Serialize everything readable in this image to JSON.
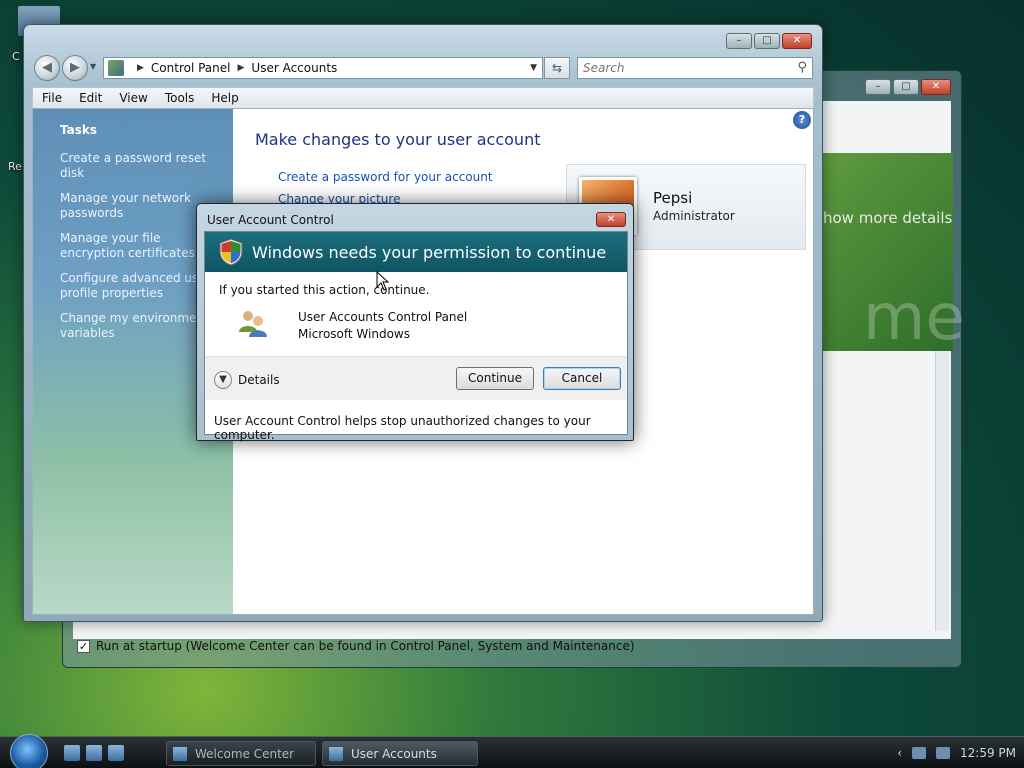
{
  "desktop": {
    "icon_label": "C",
    "icon_label2": "Re"
  },
  "welcome_window": {
    "banner_text": "how more details",
    "banner_big": "me",
    "startup_check": "✓",
    "startup_label": "Run at startup (Welcome Center can be found in Control Panel, System and Maintenance)"
  },
  "explorer": {
    "breadcrumb": [
      "Control Panel",
      "User Accounts"
    ],
    "search_placeholder": "Search",
    "menu": [
      "File",
      "Edit",
      "View",
      "Tools",
      "Help"
    ],
    "tasks_title": "Tasks",
    "tasks": [
      "Create a password reset disk",
      "Manage your network passwords",
      "Manage your file encryption certificates",
      "Configure advanced user profile properties",
      "Change my environment variables"
    ],
    "main_title": "Make changes to your user account",
    "links": [
      "Create a password for your account",
      "Change your picture"
    ],
    "user": {
      "name": "Pepsi",
      "role": "Administrator"
    }
  },
  "uac": {
    "title": "User Account Control",
    "header": "Windows needs your permission to continue",
    "message": "If you started this action, continue.",
    "program_name": "User Accounts Control Panel",
    "publisher": "Microsoft Windows",
    "details": "Details",
    "continue": "Continue",
    "cancel": "Cancel",
    "footer": "User Account Control helps stop unauthorized changes to your computer."
  },
  "taskbar": {
    "tasks": [
      "Welcome Center",
      "User Accounts"
    ],
    "clock": "12:59 PM"
  },
  "colors": {
    "uac_header": "#0f5462",
    "link": "#1b4fb0",
    "title_blue": "#1e3287"
  }
}
